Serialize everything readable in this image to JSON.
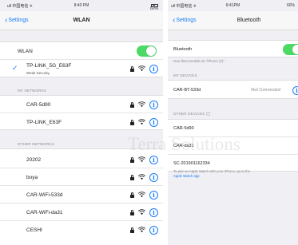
{
  "left": {
    "status": {
      "carrier": "ull 中国电信 ✈",
      "time": "8:40 PM",
      "battery": "60%"
    },
    "nav": {
      "back_label": "Settings",
      "title": "WLAN"
    },
    "wlan_toggle": {
      "label": "WLAN",
      "on": true
    },
    "connected": {
      "ssid": "TP-LINK_5G_E63F",
      "subtitle": "Weak Security"
    },
    "my_networks_header": "MY NETWORKS",
    "my_networks": [
      {
        "ssid": "CAR-5d90",
        "locked": true
      },
      {
        "ssid": "TP-LINK_E63F",
        "locked": true
      }
    ],
    "other_networks_header": "OTHER NETWORKS",
    "other_networks": [
      {
        "ssid": "20202",
        "locked": true
      },
      {
        "ssid": "boya",
        "locked": true
      },
      {
        "ssid": "CAR-WiFi-533d",
        "locked": true
      },
      {
        "ssid": "CAR-WiFi-da31",
        "locked": true
      },
      {
        "ssid": "CESHI",
        "locked": true
      }
    ]
  },
  "right": {
    "status": {
      "carrier": "ull 中国电信 ✈",
      "time": "8:41PM",
      "battery": "60%"
    },
    "nav": {
      "back_label": "Settings",
      "title": "Bluetooth"
    },
    "bt_toggle": {
      "label": "Bluetooth",
      "on": true
    },
    "discoverable_text": "Now discoverable as \"iPhone (2)\".",
    "my_devices_header": "MY DEVICES",
    "my_devices": [
      {
        "name": "CAR-BT-533d",
        "status": "Not Connected"
      }
    ],
    "other_devices_header": "OTHER DEVICES",
    "other_devices": [
      {
        "name": "CAR-5d90"
      },
      {
        "name": "CAR-da31"
      },
      {
        "name": "SC-201901162334"
      }
    ],
    "apple_watch_text": "To pair an Apple Watch with your iPhone, go to the",
    "apple_watch_link": "Apple Watch app."
  },
  "watermark": "Terra Solutions",
  "colors": {
    "accent": "#1a7cf5",
    "toggle_on": "#4cd964",
    "group_bg": "#efeff4"
  }
}
